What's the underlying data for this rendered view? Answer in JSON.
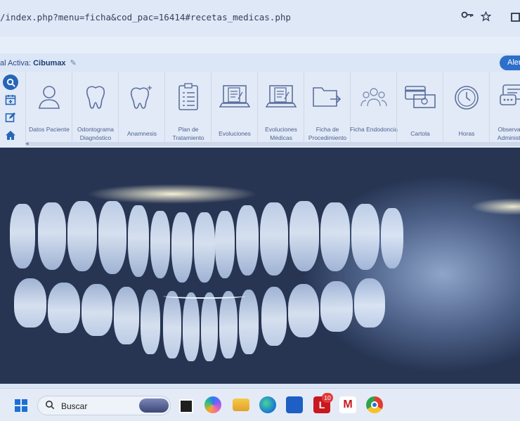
{
  "browser": {
    "url": "/index.php?menu=ficha&cod_pac=16414#recetas_medicas.php",
    "icons": [
      "key-icon",
      "star-icon",
      "collections-icon"
    ]
  },
  "header": {
    "sucursal_label": "al Activa:",
    "sucursal_value": "Cibumax",
    "alert_label": "Alert"
  },
  "sidebar_icons": [
    "search-icon",
    "calendar-add-icon",
    "edit-icon",
    "home-icon"
  ],
  "modules": [
    {
      "id": "datos-paciente",
      "label": "Datos Paciente",
      "icon": "user-icon"
    },
    {
      "id": "odontograma",
      "label": "Odontograma Diagnóstico",
      "icon": "tooth-icon"
    },
    {
      "id": "anamnesis",
      "label": "Anamnesis",
      "icon": "tooth-sparkle-icon"
    },
    {
      "id": "plan-tratamiento",
      "label": "Plan de Tratamiento",
      "icon": "clipboard-icon"
    },
    {
      "id": "evoluciones",
      "label": "Evoluciones",
      "icon": "laptop-document-icon"
    },
    {
      "id": "evoluciones-medicas",
      "label": "Evoluciones Médicas",
      "icon": "laptop-document-2-icon"
    },
    {
      "id": "ficha-procedimiento",
      "label": "Ficha de Procedimiento",
      "icon": "folder-arrow-icon"
    },
    {
      "id": "ficha-endodoncia",
      "label": "Ficha Endodoncia",
      "icon": "group-icon"
    },
    {
      "id": "cartola",
      "label": "Cartola",
      "icon": "money-cards-icon"
    },
    {
      "id": "horas",
      "label": "Horas",
      "icon": "clock-icon"
    },
    {
      "id": "observaciones",
      "label": "Observacio Administrati",
      "icon": "chat-icon"
    }
  ],
  "taskbar": {
    "search_label": "Buscar",
    "apps": [
      "windows-icon",
      "search-icon",
      "notes-icon",
      "copilot-icon",
      "file-explorer-icon",
      "edge-icon",
      "store-icon",
      "lastpass-icon",
      "mcafee-icon",
      "chrome-icon"
    ],
    "badge_count": "10"
  }
}
